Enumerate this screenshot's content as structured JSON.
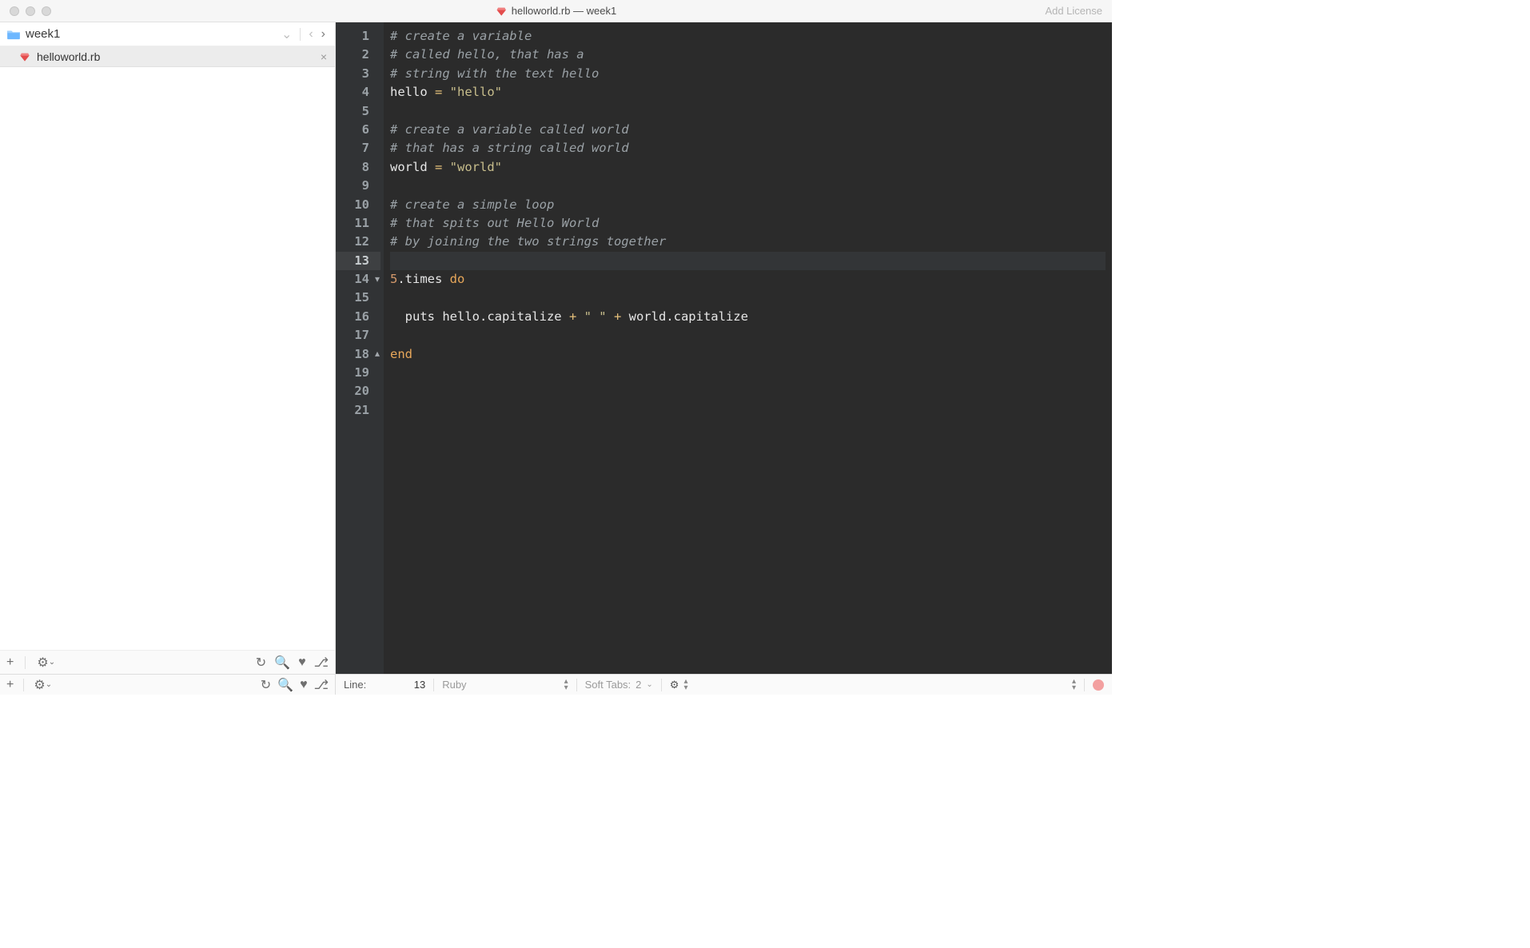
{
  "window": {
    "title": "helloworld.rb — week1",
    "add_license": "Add License"
  },
  "sidebar": {
    "project": "week1",
    "open_file": "helloworld.rb"
  },
  "editor": {
    "current_line": 13,
    "fold_open_line": 14,
    "fold_close_line": 18,
    "gutter_lines": [
      "1",
      "2",
      "3",
      "4",
      "5",
      "6",
      "7",
      "8",
      "9",
      "10",
      "11",
      "12",
      "13",
      "14",
      "15",
      "16",
      "17",
      "18",
      "19",
      "20",
      "21"
    ],
    "lines": [
      [
        {
          "cls": "tok-comment",
          "t": "# create a variable"
        }
      ],
      [
        {
          "cls": "tok-comment",
          "t": "# called hello, that has a"
        }
      ],
      [
        {
          "cls": "tok-comment",
          "t": "# string with the text hello"
        }
      ],
      [
        {
          "cls": "tok-ident",
          "t": "hello "
        },
        {
          "cls": "tok-op",
          "t": "= "
        },
        {
          "cls": "tok-str",
          "t": "\"hello\""
        }
      ],
      [],
      [
        {
          "cls": "tok-comment",
          "t": "# create a variable called world"
        }
      ],
      [
        {
          "cls": "tok-comment",
          "t": "# that has a string called world"
        }
      ],
      [
        {
          "cls": "tok-ident",
          "t": "world "
        },
        {
          "cls": "tok-op",
          "t": "= "
        },
        {
          "cls": "tok-str",
          "t": "\"world\""
        }
      ],
      [],
      [
        {
          "cls": "tok-comment",
          "t": "# create a simple loop"
        }
      ],
      [
        {
          "cls": "tok-comment",
          "t": "# that spits out Hello World"
        }
      ],
      [
        {
          "cls": "tok-comment",
          "t": "# by joining the two strings together"
        }
      ],
      [],
      [
        {
          "cls": "tok-num",
          "t": "5"
        },
        {
          "cls": "tok-ident",
          "t": ".times "
        },
        {
          "cls": "tok-kw",
          "t": "do"
        }
      ],
      [],
      [
        {
          "cls": "tok-ident",
          "t": "  puts hello.capitalize "
        },
        {
          "cls": "tok-op",
          "t": "+ "
        },
        {
          "cls": "tok-str",
          "t": "\" \""
        },
        {
          "cls": "tok-op",
          "t": " + "
        },
        {
          "cls": "tok-ident",
          "t": "world.capitalize"
        }
      ],
      [],
      [
        {
          "cls": "tok-kw",
          "t": "end"
        }
      ],
      [],
      [],
      []
    ]
  },
  "status": {
    "line_label": "Line:",
    "line_value": "13",
    "language": "Ruby",
    "indent_label": "Soft Tabs:",
    "indent_value": "2"
  },
  "icons": {
    "dropdown": "⌄",
    "prev": "‹",
    "next": "›",
    "close": "×",
    "plus": "+",
    "gear": "⚙",
    "refresh": "↻",
    "search": "🔍",
    "heart": "♥",
    "branch": "⎇"
  }
}
